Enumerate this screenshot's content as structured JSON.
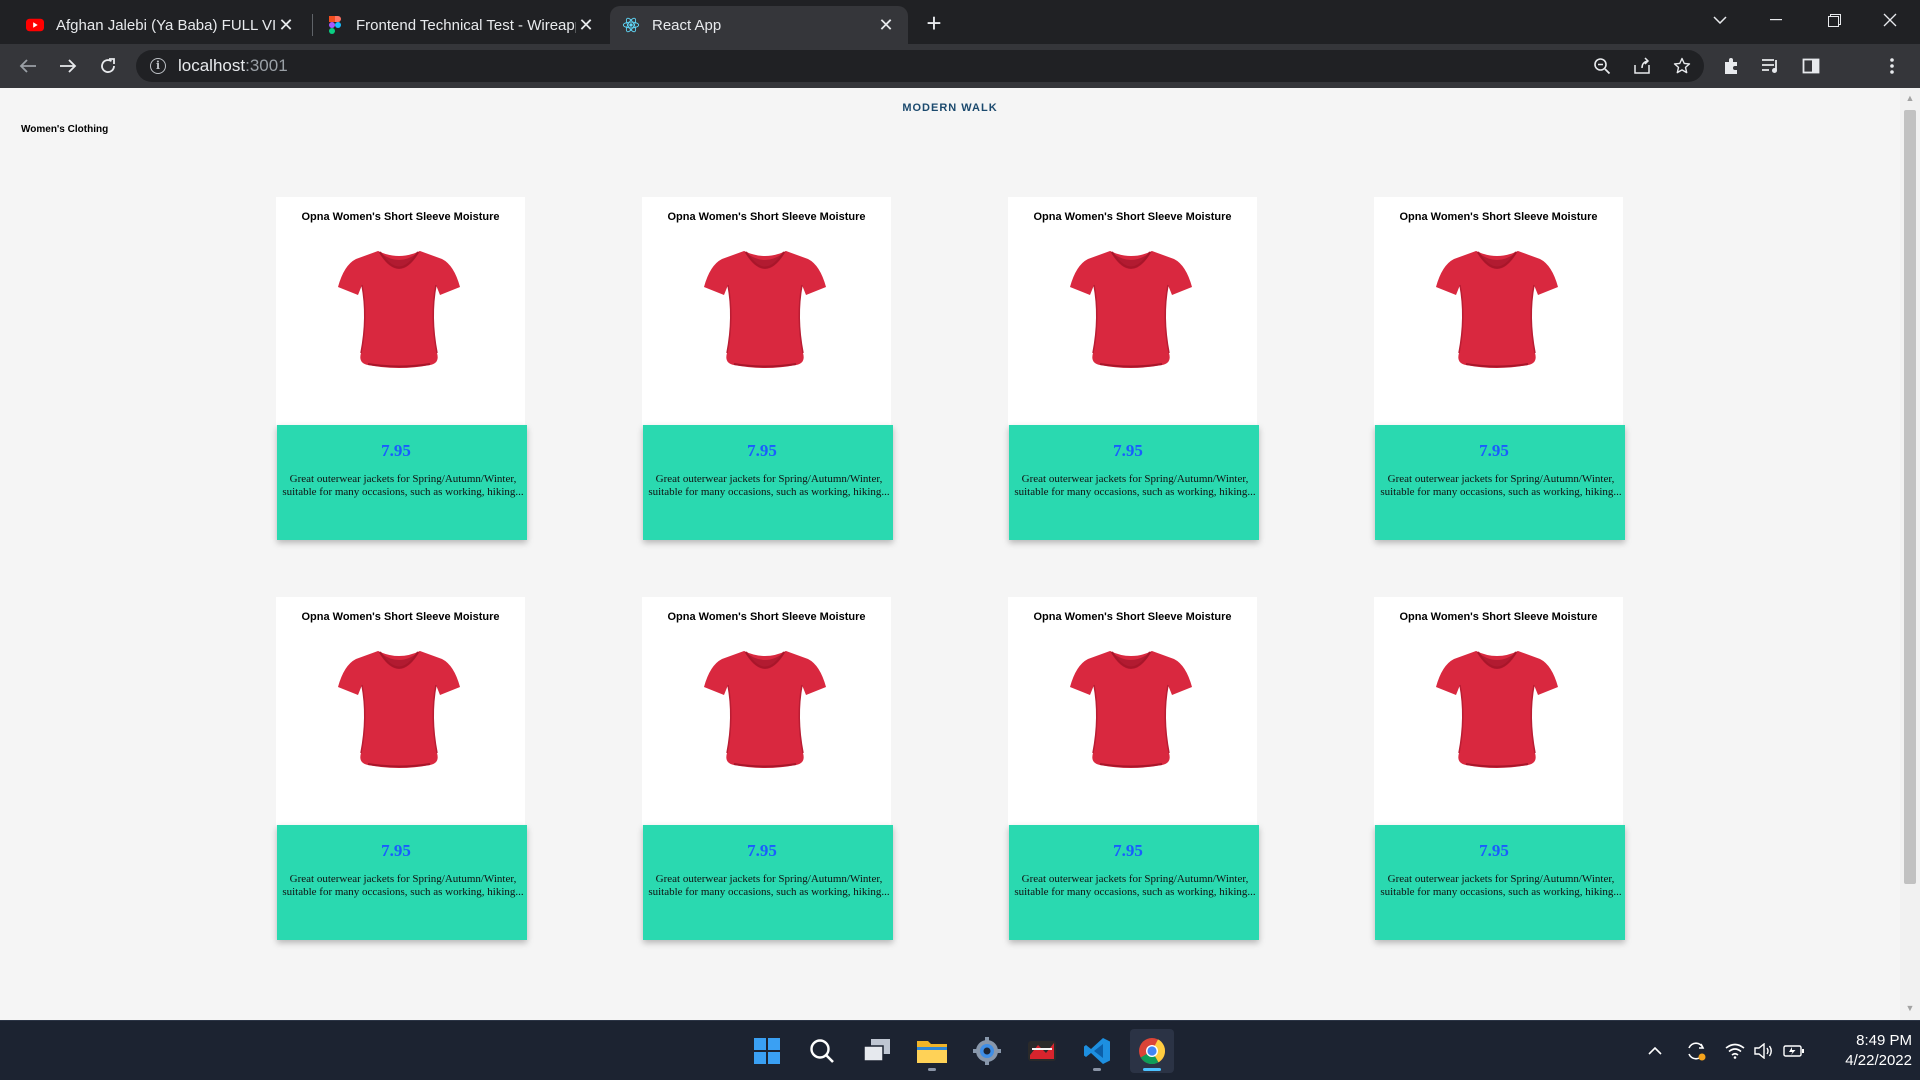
{
  "browser": {
    "tabs": [
      {
        "title": "Afghan Jalebi (Ya Baba) FULL VIDEO Song | Phantom | Saif Ali Khan",
        "icon": "youtube-icon"
      },
      {
        "title": "Frontend Technical Test - Wireapp",
        "icon": "figma-icon"
      },
      {
        "title": "React App",
        "icon": "react-icon"
      }
    ],
    "url_host": "localhost",
    "url_port": ":3001"
  },
  "page": {
    "brand": "MODERN WALK",
    "category": "Women's Clothing",
    "products": [
      {
        "title": "Opna Women's Short Sleeve Moisture",
        "price": "7.95",
        "description": "Great outerwear jackets for Spring/Autumn/Winter, suitable for many occasions, such as working, hiking..."
      },
      {
        "title": "Opna Women's Short Sleeve Moisture",
        "price": "7.95",
        "description": "Great outerwear jackets for Spring/Autumn/Winter, suitable for many occasions, such as working, hiking..."
      },
      {
        "title": "Opna Women's Short Sleeve Moisture",
        "price": "7.95",
        "description": "Great outerwear jackets for Spring/Autumn/Winter, suitable for many occasions, such as working, hiking..."
      },
      {
        "title": "Opna Women's Short Sleeve Moisture",
        "price": "7.95",
        "description": "Great outerwear jackets for Spring/Autumn/Winter, suitable for many occasions, such as working, hiking..."
      },
      {
        "title": "Opna Women's Short Sleeve Moisture",
        "price": "7.95",
        "description": "Great outerwear jackets for Spring/Autumn/Winter, suitable for many occasions, such as working, hiking..."
      },
      {
        "title": "Opna Women's Short Sleeve Moisture",
        "price": "7.95",
        "description": "Great outerwear jackets for Spring/Autumn/Winter, suitable for many occasions, such as working, hiking..."
      },
      {
        "title": "Opna Women's Short Sleeve Moisture",
        "price": "7.95",
        "description": "Great outerwear jackets for Spring/Autumn/Winter, suitable for many occasions, such as working, hiking..."
      },
      {
        "title": "Opna Women's Short Sleeve Moisture",
        "price": "7.95",
        "description": "Great outerwear jackets for Spring/Autumn/Winter, suitable for many occasions, such as working, hiking..."
      }
    ]
  },
  "colors": {
    "card_footer": "#2ad9b0",
    "price": "#1a5cff",
    "brand": "#1c4a6e",
    "shirt": "#d9283f"
  },
  "taskbar": {
    "apps": [
      "windows-start-icon",
      "search-icon",
      "task-view-icon",
      "file-explorer-icon",
      "settings-icon",
      "game-app-icon",
      "vscode-icon",
      "chrome-icon"
    ],
    "time": "8:49 PM",
    "date": "4/22/2022"
  }
}
